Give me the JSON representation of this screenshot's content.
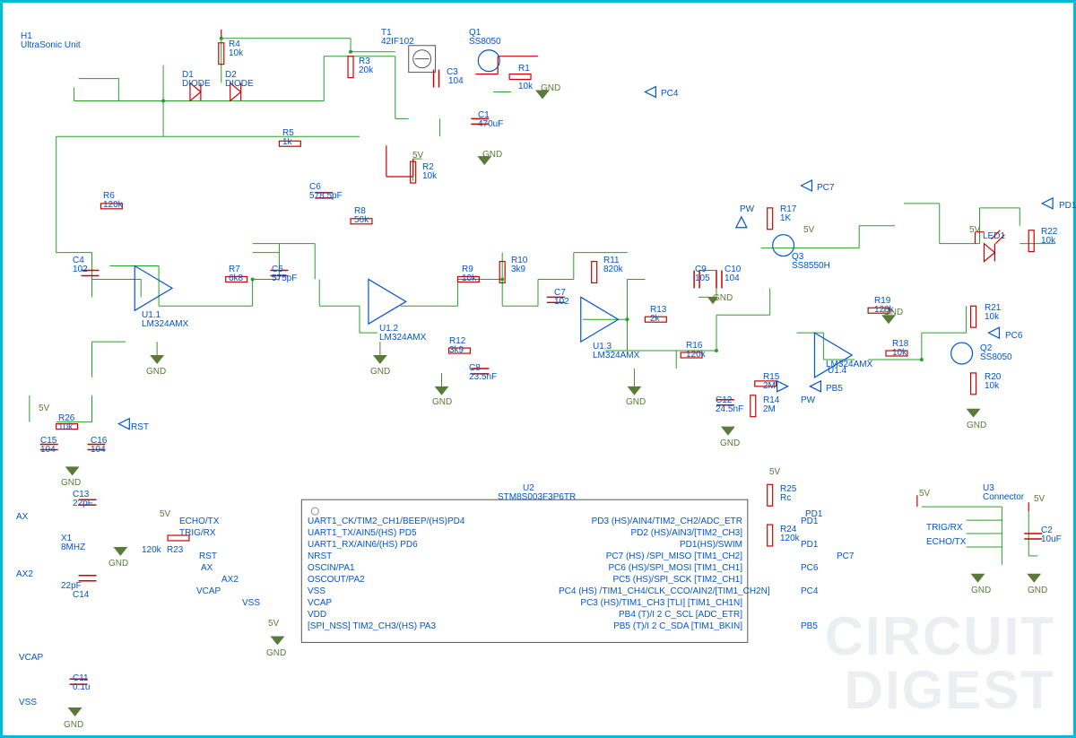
{
  "labels": {
    "H1": {
      "ref": "H1",
      "val": "UltraSonic Unit"
    },
    "T1": {
      "ref": "T1",
      "val": "42IF102"
    },
    "Q1": {
      "ref": "Q1",
      "val": "SS8050"
    },
    "Q2": {
      "ref": "Q2",
      "val": "SS8050"
    },
    "Q3": {
      "ref": "Q3",
      "val": "SS8550H"
    },
    "LED1": {
      "ref": "LED1",
      "val": ""
    },
    "D1": {
      "ref": "D1",
      "val": "DIODE"
    },
    "D2": {
      "ref": "D2",
      "val": "DIODE"
    },
    "R1": {
      "ref": "R1",
      "val": "10k"
    },
    "R2": {
      "ref": "R2",
      "val": "10k"
    },
    "R3": {
      "ref": "R3",
      "val": "20k"
    },
    "R4": {
      "ref": "R4",
      "val": "10k"
    },
    "R5": {
      "ref": "R5",
      "val": "1k"
    },
    "R6": {
      "ref": "R6",
      "val": "120k"
    },
    "R7": {
      "ref": "R7",
      "val": "6k8"
    },
    "R8": {
      "ref": "R8",
      "val": "56k"
    },
    "R9": {
      "ref": "R9",
      "val": "10k"
    },
    "R10": {
      "ref": "R10",
      "val": "3k9"
    },
    "R11": {
      "ref": "R11",
      "val": "820k"
    },
    "R12": {
      "ref": "R12",
      "val": "3k9"
    },
    "R13": {
      "ref": "R13",
      "val": "2k"
    },
    "R14": {
      "ref": "R14",
      "val": "2M"
    },
    "R15": {
      "ref": "R15",
      "val": "2M"
    },
    "R16": {
      "ref": "R16",
      "val": "120k"
    },
    "R17": {
      "ref": "R17",
      "val": "1K"
    },
    "R18": {
      "ref": "R18",
      "val": "10k"
    },
    "R19": {
      "ref": "R19",
      "val": "120k"
    },
    "R20": {
      "ref": "R20",
      "val": "10k"
    },
    "R21": {
      "ref": "R21",
      "val": "10k"
    },
    "R22": {
      "ref": "R22",
      "val": "10k"
    },
    "R23": {
      "ref": "R23",
      "val": "120k"
    },
    "R24": {
      "ref": "R24",
      "val": "120k"
    },
    "R25": {
      "ref": "R25",
      "val": "Rc"
    },
    "R26": {
      "ref": "R26",
      "val": "10k"
    },
    "C1": {
      "ref": "C1",
      "val": "470uF"
    },
    "C2": {
      "ref": "C2",
      "val": "10uF"
    },
    "C3": {
      "ref": "C3",
      "val": "104"
    },
    "C4": {
      "ref": "C4",
      "val": "102"
    },
    "C5": {
      "ref": "C5",
      "val": "575pF"
    },
    "C6": {
      "ref": "C6",
      "val": "578.5pF"
    },
    "C7": {
      "ref": "C7",
      "val": "102"
    },
    "C8": {
      "ref": "C8",
      "val": "23.5nF"
    },
    "C9": {
      "ref": "C9",
      "val": "105"
    },
    "C10": {
      "ref": "C10",
      "val": "104"
    },
    "C11": {
      "ref": "C11",
      "val": "0.1u"
    },
    "C12": {
      "ref": "C12",
      "val": "24.5nF"
    },
    "C13": {
      "ref": "C13",
      "val": "22pF"
    },
    "C14": {
      "ref": "C14",
      "val": "22pF"
    },
    "C15": {
      "ref": "C15",
      "val": "104"
    },
    "C16": {
      "ref": "C16",
      "val": "104"
    },
    "U11": {
      "ref": "U1.1",
      "val": "LM324AMX"
    },
    "U12": {
      "ref": "U1.2",
      "val": "LM324AMX"
    },
    "U13": {
      "ref": "U1.3",
      "val": "LM324AMX"
    },
    "U14": {
      "ref": "U1.4",
      "val": "LM324AMX"
    },
    "U2": {
      "ref": "U2",
      "val": "STM8S003F3P6TR"
    },
    "U3": {
      "ref": "U3",
      "val": "Connector"
    },
    "X1": {
      "ref": "X1",
      "val": "8MHZ"
    }
  },
  "nets": {
    "GND": "GND",
    "V5": "5V"
  },
  "ports": {
    "PC4": "PC4",
    "PC6": "PC6",
    "PC7": "PC7",
    "PD1": "PD1",
    "PB5": "PB5",
    "PW": "PW",
    "RST": "RST",
    "AX": "AX",
    "AX2": "AX2",
    "VCAP": "VCAP",
    "VSS": "VSS",
    "ECHO_TX": "ECHO/TX",
    "TRIG_RX": "TRIG/RX"
  },
  "mcu": {
    "left": [
      "UART1_CK/TIM2_CH1/BEEP/(HS)PD4",
      "UART1_TX/AIN5/(HS) PD5",
      "UART1_RX/AIN6/(HS) PD6",
      "NRST",
      "OSCIN/PA1",
      "OSCOUT/PA2",
      "VSS",
      "VCAP",
      "VDD",
      "[SPI_NSS] TIM2_CH3/(HS) PA3"
    ],
    "right": [
      "PD3 (HS)/AIN4/TIM2_CH2/ADC_ETR",
      "PD2 (HS)/AIN3/[TIM2_CH3]",
      "PD1(HS)/SWIM",
      "PC7 (HS) /SPI_MISO [TIM1_CH2]",
      "PC6 (HS)/SPI_MOSI [TIM1_CH1]",
      "PC5 (HS)/SPI_SCK [TIM2_CH1]",
      "PC4 (HS) /TIM1_CH4/CLK_CCO/AIN2/[TIM1_CH2N]",
      "PC3 (HS)/TIM1_CH3 [TLI] [TIM1_CH1N]",
      "PB4 (T)/I 2 C_SCL [ADC_ETR]",
      "PB5 (T)/I 2 C_SDA [TIM1_BKIN]"
    ]
  },
  "watermark": {
    "line1": "CIRCUIT",
    "line2": "DIGEST"
  }
}
